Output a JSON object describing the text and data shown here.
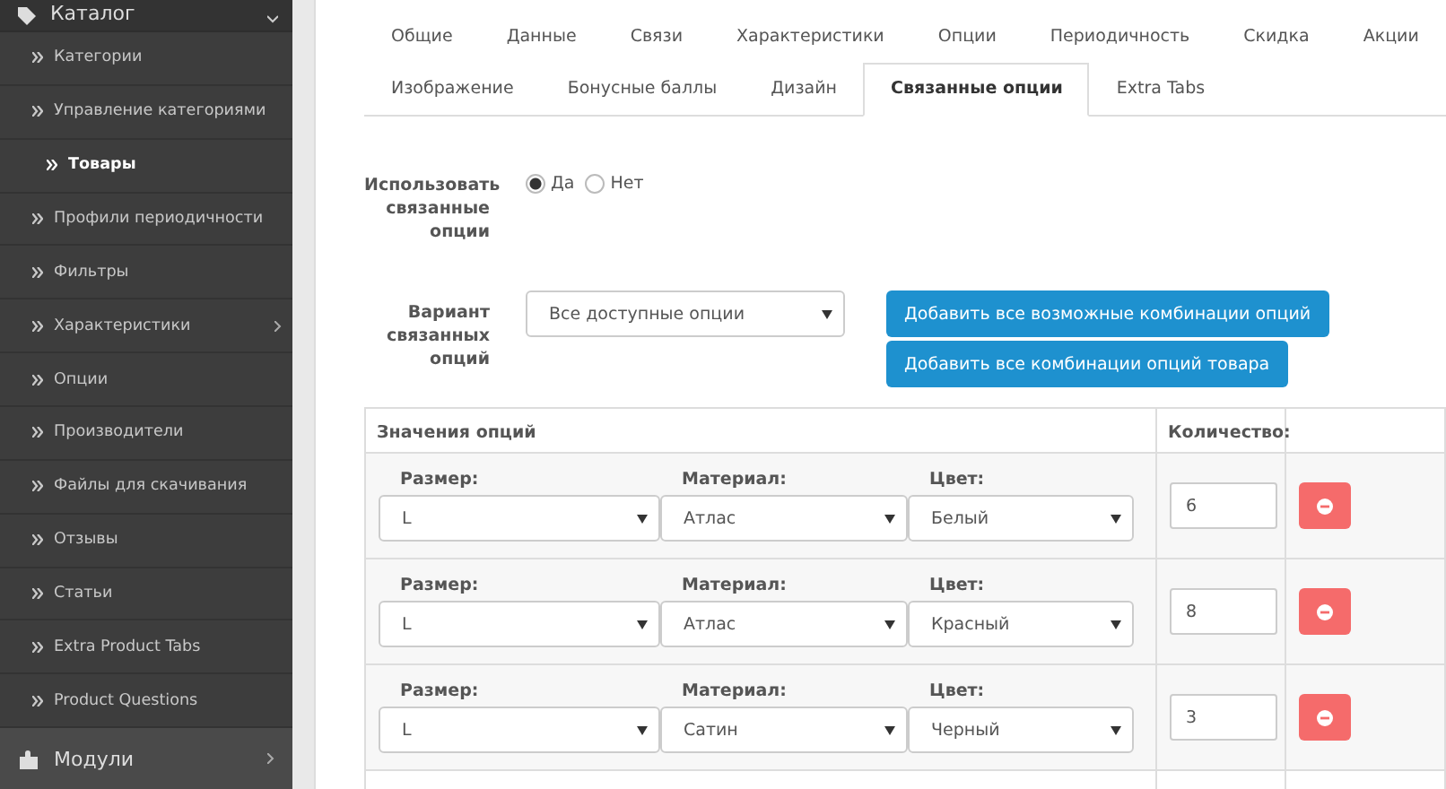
{
  "sidebar": {
    "section": {
      "label": "Каталог",
      "expanded": true
    },
    "items": [
      {
        "label": "Категории",
        "selected": false,
        "has_submenu": false
      },
      {
        "label": "Управление категориями",
        "selected": false,
        "has_submenu": false
      },
      {
        "label": "Товары",
        "selected": true,
        "has_submenu": false
      },
      {
        "label": "Профили периодичности",
        "selected": false,
        "has_submenu": false
      },
      {
        "label": "Фильтры",
        "selected": false,
        "has_submenu": false
      },
      {
        "label": "Характеристики",
        "selected": false,
        "has_submenu": true
      },
      {
        "label": "Опции",
        "selected": false,
        "has_submenu": false
      },
      {
        "label": "Производители",
        "selected": false,
        "has_submenu": false
      },
      {
        "label": "Файлы для скачивания",
        "selected": false,
        "has_submenu": false
      },
      {
        "label": "Отзывы",
        "selected": false,
        "has_submenu": false
      },
      {
        "label": "Статьи",
        "selected": false,
        "has_submenu": false
      },
      {
        "label": "Extra Product Tabs",
        "selected": false,
        "has_submenu": false
      },
      {
        "label": "Product Questions",
        "selected": false,
        "has_submenu": false
      }
    ],
    "next_section": {
      "label": "Модули"
    }
  },
  "tabs": [
    [
      {
        "label": "Общие",
        "selected": false
      },
      {
        "label": "Данные",
        "selected": false
      },
      {
        "label": "Связи",
        "selected": false
      },
      {
        "label": "Характеристики",
        "selected": false
      },
      {
        "label": "Опции",
        "selected": false
      },
      {
        "label": "Периодичность",
        "selected": false
      },
      {
        "label": "Скидка",
        "selected": false
      },
      {
        "label": "Акции",
        "selected": false
      }
    ],
    [
      {
        "label": "Изображение",
        "selected": false
      },
      {
        "label": "Бонусные баллы",
        "selected": false
      },
      {
        "label": "Дизайн",
        "selected": false
      },
      {
        "label": "Связанные опции",
        "selected": true
      },
      {
        "label": "Extra Tabs",
        "selected": false
      }
    ]
  ],
  "use_related": {
    "label": "Использовать связанные опции",
    "options": [
      {
        "label": "Да",
        "selected": true
      },
      {
        "label": "Нет",
        "selected": false
      }
    ]
  },
  "variant": {
    "label": "Вариант связанных опций",
    "value": "Все доступные опции",
    "buttons": [
      "Добавить все возможные комбинации опций",
      "Добавить все комбинации опций товара"
    ]
  },
  "table": {
    "columns": [
      "Значения опций",
      "Количество:"
    ],
    "rows": [
      {
        "fields": [
          {
            "label": "Размер:",
            "value": "L"
          },
          {
            "label": "Материал:",
            "value": "Атлас"
          },
          {
            "label": "Цвет:",
            "value": "Белый"
          }
        ],
        "quantity": "6"
      },
      {
        "fields": [
          {
            "label": "Размер:",
            "value": "L"
          },
          {
            "label": "Материал:",
            "value": "Атлас"
          },
          {
            "label": "Цвет:",
            "value": "Красный"
          }
        ],
        "quantity": "8"
      },
      {
        "fields": [
          {
            "label": "Размер:",
            "value": "L"
          },
          {
            "label": "Материал:",
            "value": "Сатин"
          },
          {
            "label": "Цвет:",
            "value": "Черный"
          }
        ],
        "quantity": "3"
      }
    ]
  }
}
